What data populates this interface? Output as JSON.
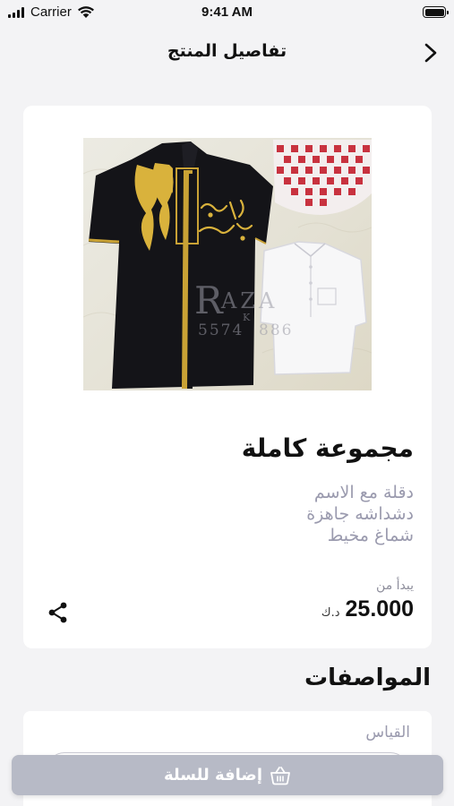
{
  "status_bar": {
    "carrier": "Carrier",
    "time": "9:41 AM"
  },
  "nav": {
    "title": "تفاصيل المنتج",
    "back_icon": "chevron-right-icon"
  },
  "product": {
    "image_watermark": "RAZA",
    "image_watermark_sub": "K",
    "image_watermark_number": "5574",
    "image_watermark_number_end": "886",
    "embroidery_text_1": "عبدالله",
    "embroidery_text_2": "العليوي",
    "name": "مجموعة كاملة",
    "description_lines": [
      "دقلة مع الاسم",
      "دشداشه جاهزة",
      "شماغ مخيط"
    ],
    "price_prefix": "يبدأ من",
    "price": "25.000",
    "currency": "د.ك",
    "share_icon": "share-icon"
  },
  "specs": {
    "heading": "المواصفات",
    "size_label": "القياس",
    "size_value": ""
  },
  "cart": {
    "add_label": "إضافة للسلة",
    "icon": "basket-icon"
  },
  "colors": {
    "background": "#f3f3f5",
    "card": "#ffffff",
    "muted_text": "#9a9aae",
    "button": "#b7bac6"
  }
}
